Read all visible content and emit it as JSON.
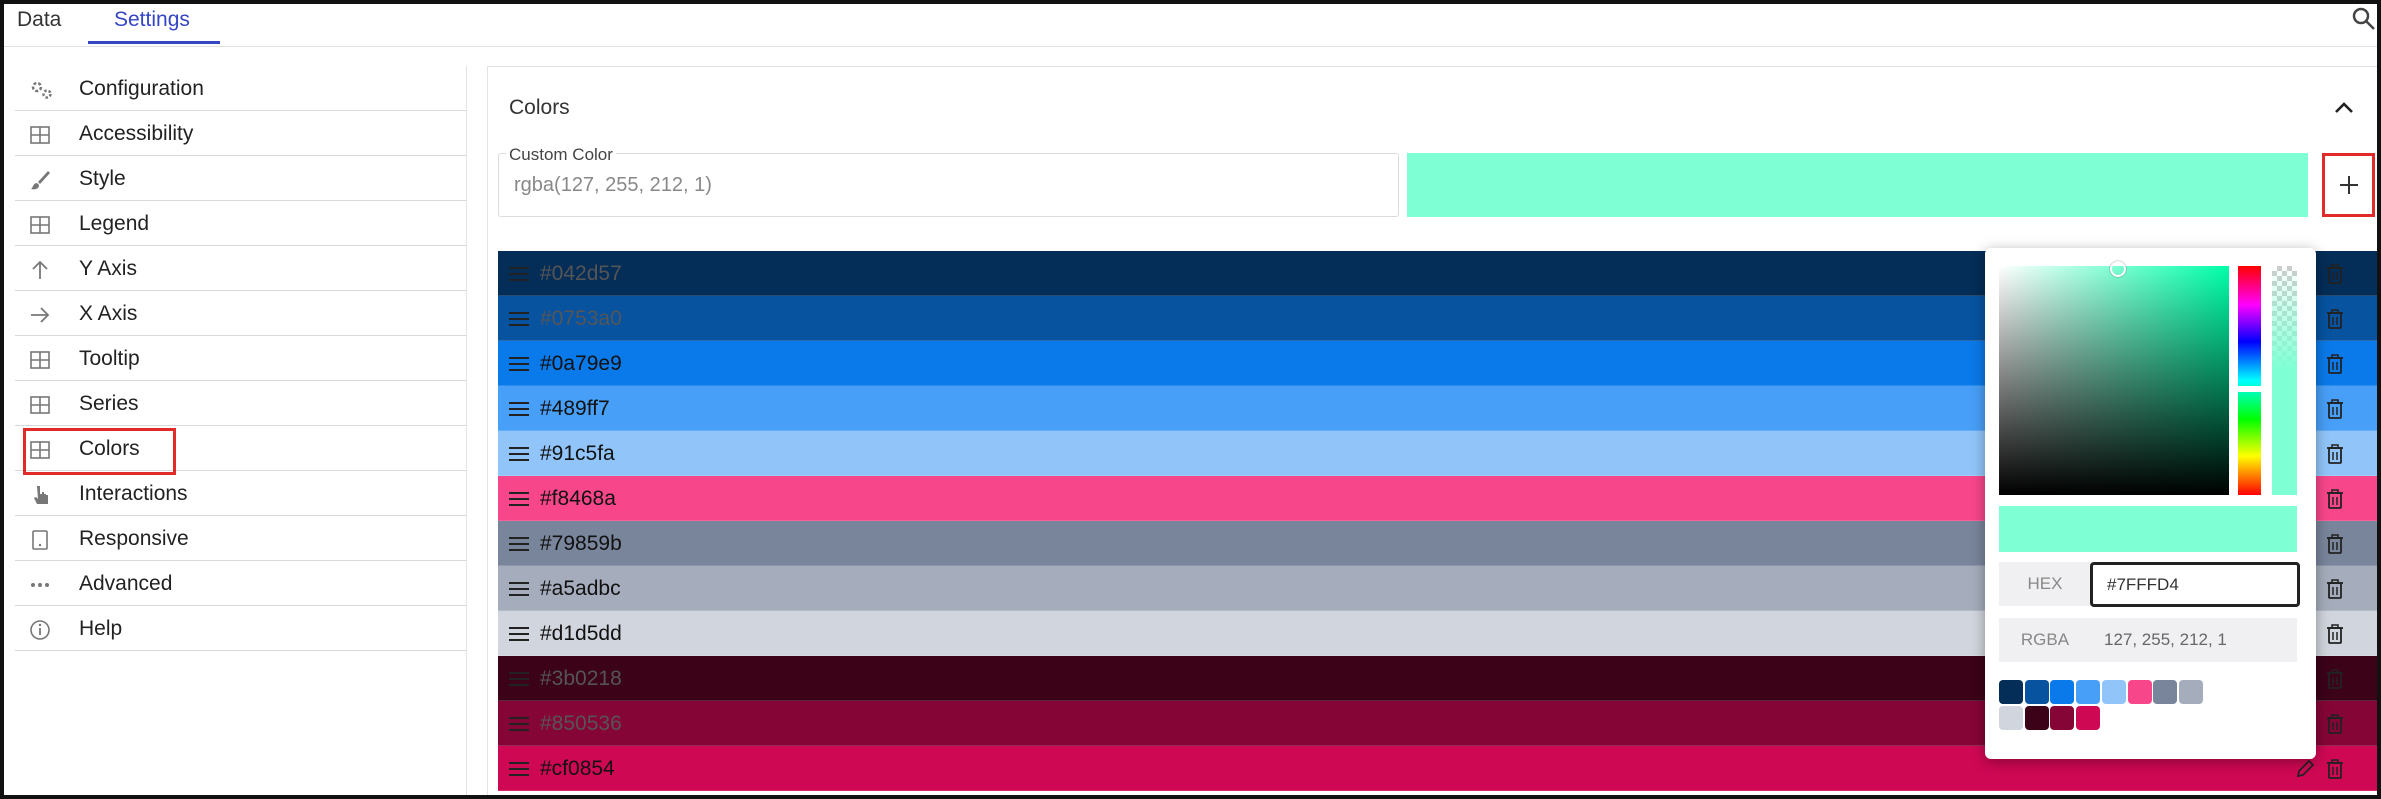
{
  "tabs": [
    {
      "label": "Data"
    },
    {
      "label": "Settings"
    }
  ],
  "sidebar": {
    "items": [
      {
        "label": "Configuration",
        "icon": "gears-icon"
      },
      {
        "label": "Accessibility",
        "icon": "grid-icon"
      },
      {
        "label": "Style",
        "icon": "brush-icon"
      },
      {
        "label": "Legend",
        "icon": "grid-icon"
      },
      {
        "label": "Y Axis",
        "icon": "arrow-up-icon"
      },
      {
        "label": "X Axis",
        "icon": "arrow-right-icon"
      },
      {
        "label": "Tooltip",
        "icon": "grid-icon"
      },
      {
        "label": "Series",
        "icon": "grid-icon"
      },
      {
        "label": "Colors",
        "icon": "grid-icon"
      },
      {
        "label": "Interactions",
        "icon": "pointer-hand-icon"
      },
      {
        "label": "Responsive",
        "icon": "device-icon"
      },
      {
        "label": "Advanced",
        "icon": "more-dots-icon"
      },
      {
        "label": "Help",
        "icon": "info-icon"
      }
    ],
    "selected": "Colors"
  },
  "panel": {
    "title": "Colors",
    "custom_color": {
      "label": "Custom Color",
      "value": "rgba(127, 255, 212, 1)",
      "preview_color": "#7fffd4"
    },
    "colors": [
      {
        "hex": "#042d57"
      },
      {
        "hex": "#0753a0"
      },
      {
        "hex": "#0a79e9"
      },
      {
        "hex": "#489ff7"
      },
      {
        "hex": "#91c5fa"
      },
      {
        "hex": "#f8468a"
      },
      {
        "hex": "#79859b"
      },
      {
        "hex": "#a5adbc"
      },
      {
        "hex": "#d1d5dd"
      },
      {
        "hex": "#3b0218"
      },
      {
        "hex": "#850536"
      },
      {
        "hex": "#cf0854"
      }
    ]
  },
  "picker": {
    "hex_label": "HEX",
    "hex_value": "#7FFFD4",
    "rgba_label": "RGBA",
    "rgba_value": "127, 255, 212, 1",
    "preview_color": "#7fffd4",
    "swatches": [
      "#042d57",
      "#0753a0",
      "#0a79e9",
      "#489ff7",
      "#91c5fa",
      "#f8468a",
      "#79859b",
      "#a5adbc",
      "#d1d5dd",
      "#3b0218",
      "#850536",
      "#cf0854"
    ]
  },
  "accent_color": "#3546c4",
  "highlight_color": "#e12a2a"
}
